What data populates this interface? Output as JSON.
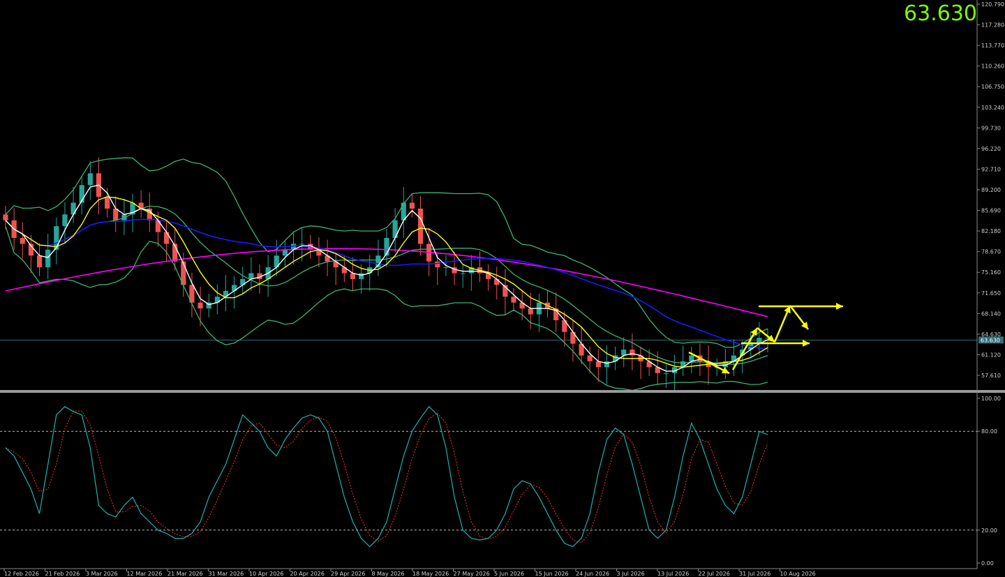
{
  "header": {
    "last_price": "63.630"
  },
  "colors": {
    "background": "#000000",
    "bull_candle": "#26a69a",
    "bear_candle": "#ef5350",
    "bollinger": "#3cb371",
    "ma_fast": "#ffffff",
    "ma_mid": "#ffff00",
    "ma_slow": "#1a1aff",
    "ma_long": "#ff00ff",
    "stoch_main": "#20b2aa",
    "stoch_signal": "#ff3030",
    "arrows": "#ffff00",
    "price_line": "#2f6f7a",
    "big_price": "#7cfc00"
  },
  "chart_data": [
    {
      "type": "candlestick",
      "panel": "price",
      "y_ticks": [
        "120.790",
        "117.280",
        "113.770",
        "110.260",
        "106.750",
        "103.240",
        "99.730",
        "96.220",
        "92.710",
        "89.200",
        "85.690",
        "82.180",
        "78.670",
        "75.160",
        "71.650",
        "68.140",
        "64.630",
        "61.120",
        "57.610"
      ],
      "ylim": [
        55.0,
        121.5
      ],
      "current_price": 63.63,
      "current_price_label": "63.630",
      "x_ticks": [
        "12 Feb 2026",
        "21 Feb 2026",
        "3 Mar 2026",
        "12 Mar 2026",
        "21 Mar 2026",
        "31 Mar 2026",
        "10 Apr 2026",
        "20 Apr 2026",
        "29 Apr 2026",
        "8 May 2026",
        "18 May 2026",
        "27 May 2026",
        "5 Jun 2026",
        "15 Jun 2026",
        "24 Jun 2026",
        "3 Jul 2026",
        "13 Jul 2026",
        "22 Jul 2026",
        "31 Jul 2026",
        "10 Aug 2026"
      ],
      "series_close_approx": [
        84,
        81,
        80,
        78,
        76,
        79,
        83,
        85,
        87,
        90,
        92,
        88,
        86,
        84,
        85,
        87,
        86,
        84,
        82,
        80,
        77,
        73,
        70,
        69,
        70,
        71,
        72,
        73,
        74,
        75,
        74,
        76,
        78,
        79,
        80,
        80,
        79,
        78,
        77,
        76,
        75,
        74,
        75,
        76,
        78,
        81,
        84,
        87,
        86,
        80,
        77,
        76,
        76,
        75,
        75,
        76,
        75,
        74,
        73,
        71,
        70,
        69,
        68,
        70,
        69,
        67,
        65,
        63,
        61,
        60,
        59,
        60,
        61,
        62,
        61,
        60,
        59,
        58,
        58,
        59,
        60,
        61,
        60,
        59,
        59,
        60,
        61,
        62,
        63,
        64,
        64
      ],
      "overlays": [
        "Bollinger upper",
        "Bollinger middle",
        "Bollinger lower",
        "MA fast (white)",
        "MA (yellow)",
        "MA (blue)",
        "MA (magenta)"
      ]
    },
    {
      "type": "line",
      "panel": "stochastic",
      "y_ticks": [
        "100.00",
        "80.00",
        "20.00",
        "0.00"
      ],
      "ylim": [
        0,
        100
      ],
      "levels": [
        80,
        20
      ],
      "main_values": [
        70,
        65,
        55,
        45,
        30,
        60,
        90,
        95,
        92,
        90,
        70,
        35,
        30,
        28,
        35,
        40,
        30,
        25,
        20,
        18,
        15,
        15,
        18,
        25,
        40,
        50,
        60,
        75,
        90,
        85,
        80,
        70,
        65,
        75,
        82,
        88,
        90,
        88,
        80,
        60,
        40,
        25,
        15,
        10,
        15,
        25,
        45,
        65,
        80,
        88,
        95,
        90,
        70,
        40,
        20,
        15,
        14,
        15,
        20,
        30,
        45,
        50,
        48,
        40,
        30,
        20,
        12,
        10,
        15,
        30,
        55,
        75,
        82,
        78,
        60,
        40,
        20,
        15,
        20,
        40,
        65,
        85,
        75,
        60,
        45,
        35,
        30,
        40,
        60,
        80,
        78
      ]
    }
  ]
}
